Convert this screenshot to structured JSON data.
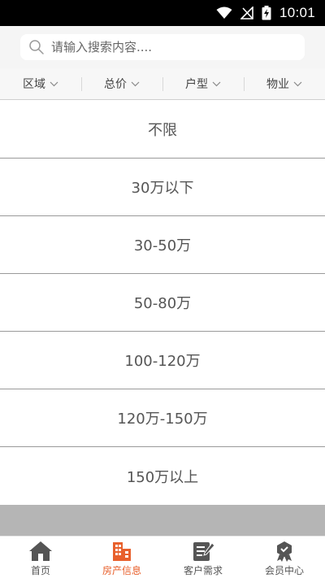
{
  "status_bar": {
    "time": "10:01",
    "icons": [
      "wifi-icon",
      "signal-icon",
      "battery-charging-icon"
    ]
  },
  "search": {
    "placeholder": "请输入搜索内容....",
    "value": "",
    "icon": "search-icon"
  },
  "filters": [
    {
      "label": "区域",
      "icon": "chevron-down-icon"
    },
    {
      "label": "总价",
      "icon": "chevron-down-icon"
    },
    {
      "label": "户型",
      "icon": "chevron-down-icon"
    },
    {
      "label": "物业",
      "icon": "chevron-down-icon"
    }
  ],
  "price_options": [
    "不限",
    "30万以下",
    "30-50万",
    "50-80万",
    "100-120万",
    "120万-150万",
    "150万以上"
  ],
  "bottom_nav": [
    {
      "label": "首页",
      "icon": "home-icon",
      "active": false
    },
    {
      "label": "房产信息",
      "icon": "building-icon",
      "active": true
    },
    {
      "label": "客户需求",
      "icon": "edit-note-icon",
      "active": false
    },
    {
      "label": "会员中心",
      "icon": "member-badge-icon",
      "active": false
    }
  ],
  "colors": {
    "accent": "#e8602c",
    "nav_inactive": "#555555",
    "status_bar": "#000000",
    "divider": "#9a9a9a"
  }
}
